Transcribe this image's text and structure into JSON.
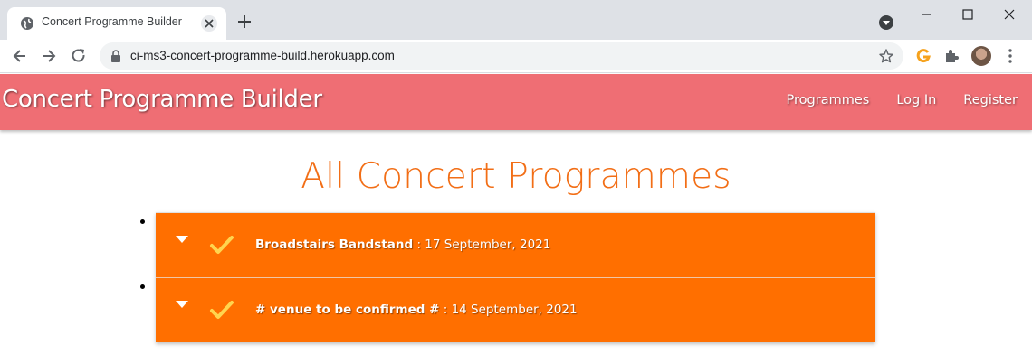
{
  "browser": {
    "tab_title": "Concert Programme Builder",
    "url": "ci-ms3-concert-programme-build.herokuapp.com",
    "icons": [
      "globe-icon",
      "close-icon",
      "plus-icon",
      "minimize-icon",
      "maximize-icon",
      "close-window-icon",
      "back-arrow-icon",
      "forward-arrow-icon",
      "reload-icon",
      "lock-icon",
      "star-icon",
      "grammarly-icon",
      "puzzle-icon",
      "kebab-menu-icon"
    ]
  },
  "navbar": {
    "brand": "Concert Programme Builder",
    "links": [
      "Programmes",
      "Log In",
      "Register"
    ],
    "background": "#ef6e74"
  },
  "main": {
    "title": "All Concert Programmes",
    "title_color": "#f26e16",
    "row_color": "#ff6f00",
    "programmes": [
      {
        "venue": "Broadstairs Bandstand",
        "date": " : 17 September, 2021"
      },
      {
        "venue": "# venue to be confirmed #",
        "date": " : 14 September, 2021"
      }
    ]
  }
}
